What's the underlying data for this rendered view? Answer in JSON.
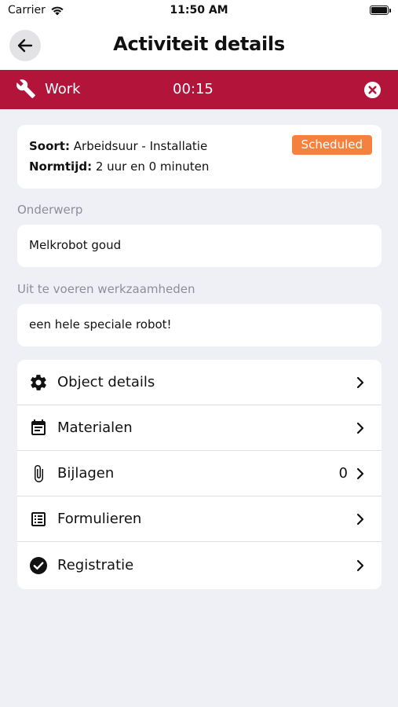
{
  "status_bar": {
    "carrier": "Carrier",
    "time": "11:50 AM"
  },
  "nav": {
    "title": "Activiteit details"
  },
  "timer": {
    "label": "Work",
    "time": "00:15"
  },
  "info": {
    "type_label": "Soort:",
    "type_value": "Arbeidsuur - Installatie",
    "norm_label": "Normtijd:",
    "norm_value": "2 uur en 0 minuten",
    "status": "Scheduled",
    "status_color": "#f5813f"
  },
  "subject": {
    "label": "Onderwerp",
    "value": "Melkrobot goud"
  },
  "work": {
    "label": "Uit te voeren werkzaamheden",
    "value": "een hele speciale robot!"
  },
  "menu": [
    {
      "label": "Object details",
      "icon": "gear-icon"
    },
    {
      "label": "Materialen",
      "icon": "calendar-icon"
    },
    {
      "label": "Bijlagen",
      "icon": "paperclip-icon",
      "count": "0"
    },
    {
      "label": "Formulieren",
      "icon": "list-icon"
    },
    {
      "label": "Registratie",
      "icon": "check-circle-icon"
    }
  ],
  "colors": {
    "accent": "#b3143a",
    "background": "#efeff6"
  }
}
